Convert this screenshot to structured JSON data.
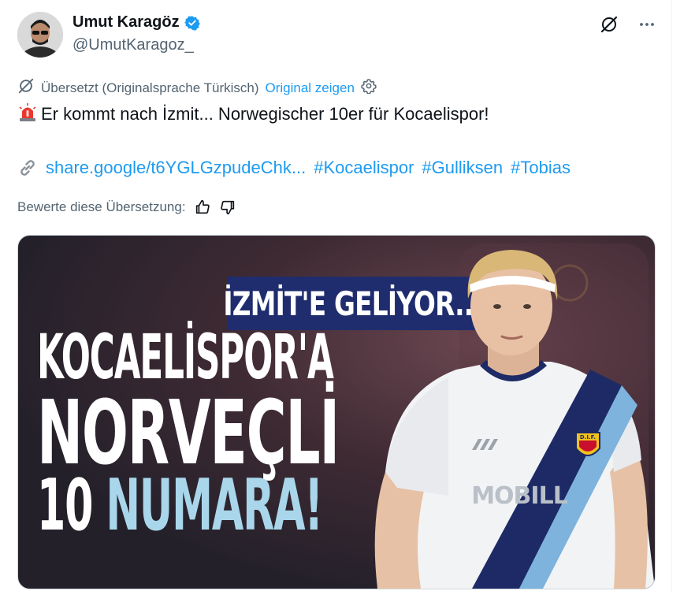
{
  "author": {
    "name": "Umut Karagöz",
    "handle": "@UmutKaragoz_"
  },
  "translation": {
    "status": "Übersetzt (Originalsprache Türkisch)",
    "show_original": "Original zeigen"
  },
  "tweet": {
    "text": "Er kommt nach İzmit... Norwegischer 10er für Kocaelispor!",
    "link": "share.google/t6YGLGzpudeChk...",
    "hashtags": [
      "#Kocaelispor",
      "#Gulliksen",
      "#Tobias"
    ]
  },
  "rating": {
    "label": "Bewerte diese Übersetzung:"
  },
  "media": {
    "banner": "İZMİT'E GELİYOR...",
    "line1": "KOCAELİSPOR'A",
    "line2": "NORVEÇLİ",
    "line3_num": "10",
    "line3_word": "NUMARA!",
    "shirt_sponsor": "MOBILL",
    "crest_text": "D.I.F."
  },
  "colors": {
    "link": "#1d9bf0",
    "secondary_text": "#536471",
    "verified": "#1d9bf0",
    "banner_bg": "#1f2d6e",
    "accent_light_blue": "#a9d6ea"
  },
  "icons": [
    "verified-badge-icon",
    "grok-icon",
    "more-icon",
    "translate-icon",
    "settings-icon",
    "siren-emoji-icon",
    "link-icon",
    "thumbs-up-icon",
    "thumbs-down-icon"
  ]
}
